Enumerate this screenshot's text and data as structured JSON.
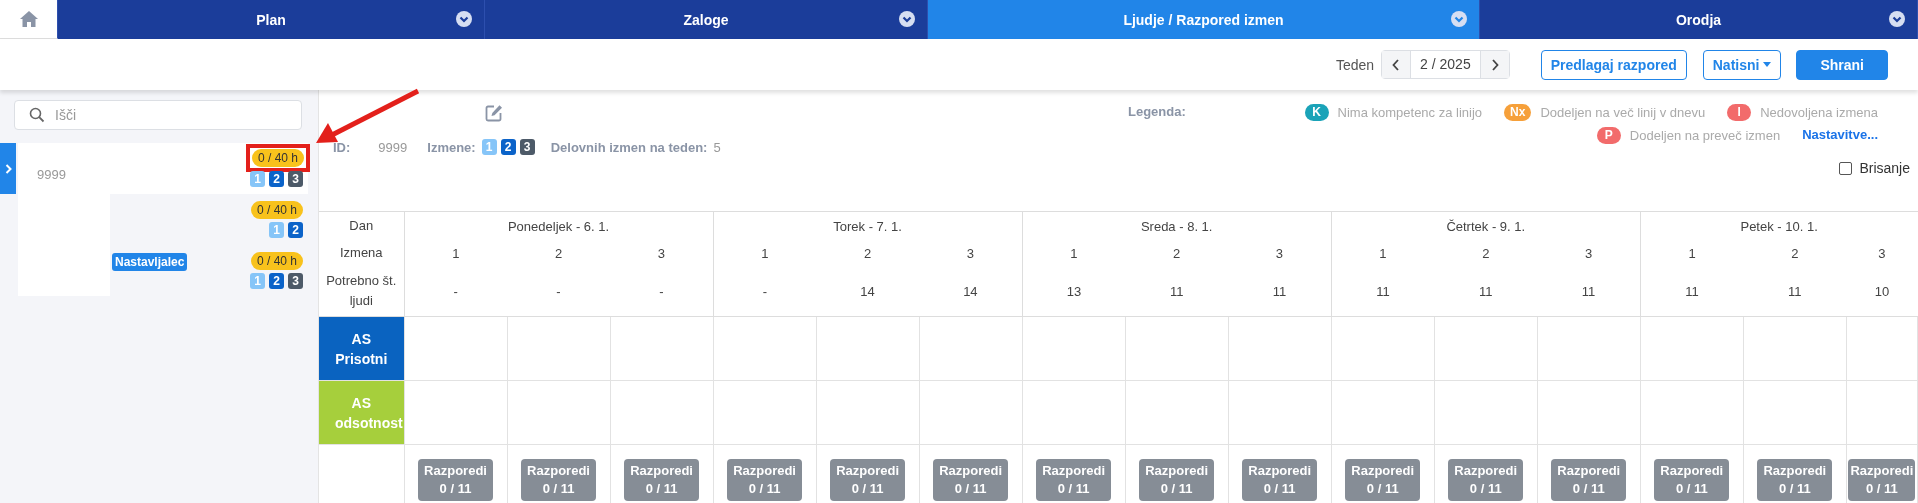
{
  "nav": {
    "tabs": [
      {
        "kind": "home",
        "selected": false
      },
      {
        "kind": "menu",
        "label": "Plan",
        "selected": false
      },
      {
        "kind": "menu",
        "label": "Zaloge",
        "selected": false
      },
      {
        "kind": "menu",
        "label": "Ljudje / Razpored izmen",
        "selected": true
      },
      {
        "kind": "menu",
        "label": "Orodja",
        "selected": false
      }
    ]
  },
  "toolbar": {
    "week_label": "Teden",
    "week_value": "2 / 2025",
    "buttons": [
      {
        "kind": "outline",
        "label": "Predlagaj razpored"
      },
      {
        "kind": "dropdown",
        "label": "Natisni"
      },
      {
        "kind": "primary",
        "label": "Shrani"
      }
    ]
  },
  "sidebar": {
    "search": {
      "placeholder": "Išči"
    },
    "employees": [
      {
        "selected": true,
        "id_text": "9999",
        "hours": "0 / 40 h",
        "callout": true,
        "shifts": [
          {
            "label": "1",
            "color": "#86c5f8"
          },
          {
            "label": "2",
            "color": "#0b63c9"
          },
          {
            "label": "3",
            "color": "#4d5a68"
          }
        ]
      },
      {
        "selected": false,
        "hours": "0 / 40 h",
        "callout": false,
        "shifts": [
          {
            "label": "1",
            "color": "#86c5f8"
          },
          {
            "label": "2",
            "color": "#0b63c9"
          }
        ]
      },
      {
        "selected": false,
        "tag": "Nastavljalec",
        "hours": "0 / 40 h",
        "callout": false,
        "shifts": [
          {
            "label": "1",
            "color": "#86c5f8"
          },
          {
            "label": "2",
            "color": "#0b63c9"
          },
          {
            "label": "3",
            "color": "#4d5a68"
          }
        ]
      }
    ]
  },
  "detail": {
    "id_label": "ID:",
    "id_value": "9999",
    "shifts_label": "Izmene:",
    "shifts": [
      {
        "label": "1",
        "color": "#86c5f8"
      },
      {
        "label": "2",
        "color": "#0b63c9"
      },
      {
        "label": "3",
        "color": "#4d5a68"
      }
    ],
    "weekly_label": "Delovnih izmen na teden:",
    "weekly_value": "5"
  },
  "legend": {
    "label": "Legenda:",
    "items": [
      {
        "badge": "K",
        "text": "Nima kompetenc za linijo",
        "color": "#1aa3b8"
      },
      {
        "badge": "Nx",
        "text": "Dodeljen na več linij v dnevu",
        "color": "#f6a03a"
      },
      {
        "badge": "I",
        "text": "Nedovoljena izmena",
        "color": "#f26b6b"
      },
      {
        "badge": "P",
        "text": "Dodeljen na preveč izmen",
        "color": "#f26b6b"
      }
    ],
    "settings_link": "Nastavitve..."
  },
  "delete_checkbox": {
    "label": "Brisanje",
    "checked": false
  },
  "table": {
    "row_headers": {
      "day": "Dan",
      "shift": "Izmena",
      "required": "Potrebno št. ljudi"
    },
    "days": [
      {
        "label": "Ponedeljek - 6. 1.",
        "shifts": [
          {
            "number": "1",
            "required": "-"
          },
          {
            "number": "2",
            "required": "-"
          },
          {
            "number": "3",
            "required": "-"
          }
        ]
      },
      {
        "label": "Torek - 7. 1.",
        "shifts": [
          {
            "number": "1",
            "required": "-"
          },
          {
            "number": "2",
            "required": "14"
          },
          {
            "number": "3",
            "required": "14"
          }
        ]
      },
      {
        "label": "Sreda - 8. 1.",
        "shifts": [
          {
            "number": "1",
            "required": "13"
          },
          {
            "number": "2",
            "required": "11"
          },
          {
            "number": "3",
            "required": "11"
          }
        ]
      },
      {
        "label": "Četrtek - 9. 1.",
        "shifts": [
          {
            "number": "1",
            "required": "11"
          },
          {
            "number": "2",
            "required": "11"
          },
          {
            "number": "3",
            "required": "11"
          }
        ]
      },
      {
        "label": "Petek - 10. 1.",
        "shifts": [
          {
            "number": "1",
            "required": "11"
          },
          {
            "number": "2",
            "required": "11"
          },
          {
            "number": "3",
            "required": "10"
          }
        ]
      }
    ],
    "groups": [
      {
        "label": "AS Prisotni",
        "color": "#0a63c0"
      },
      {
        "label": "AS odsotnost",
        "color": "#a6cf3c"
      }
    ],
    "assign_buttons": [
      {
        "label": "Razporedi",
        "count": "0 / 11"
      },
      {
        "label": "Razporedi",
        "count": "0 / 11"
      },
      {
        "label": "Razporedi",
        "count": "0 / 11"
      },
      {
        "label": "Razporedi",
        "count": "0 / 11"
      },
      {
        "label": "Razporedi",
        "count": "0 / 11"
      },
      {
        "label": "Razporedi",
        "count": "0 / 11"
      },
      {
        "label": "Razporedi",
        "count": "0 / 11"
      },
      {
        "label": "Razporedi",
        "count": "0 / 11"
      },
      {
        "label": "Razporedi",
        "count": "0 / 11"
      },
      {
        "label": "Razporedi",
        "count": "0 / 11"
      },
      {
        "label": "Razporedi",
        "count": "0 / 11"
      },
      {
        "label": "Razporedi",
        "count": "0 / 11"
      },
      {
        "label": "Razporedi",
        "count": "0 / 11"
      },
      {
        "label": "Razporedi",
        "count": "0 / 11"
      },
      {
        "label": "Razporedi",
        "count": "0 / 11"
      }
    ]
  }
}
